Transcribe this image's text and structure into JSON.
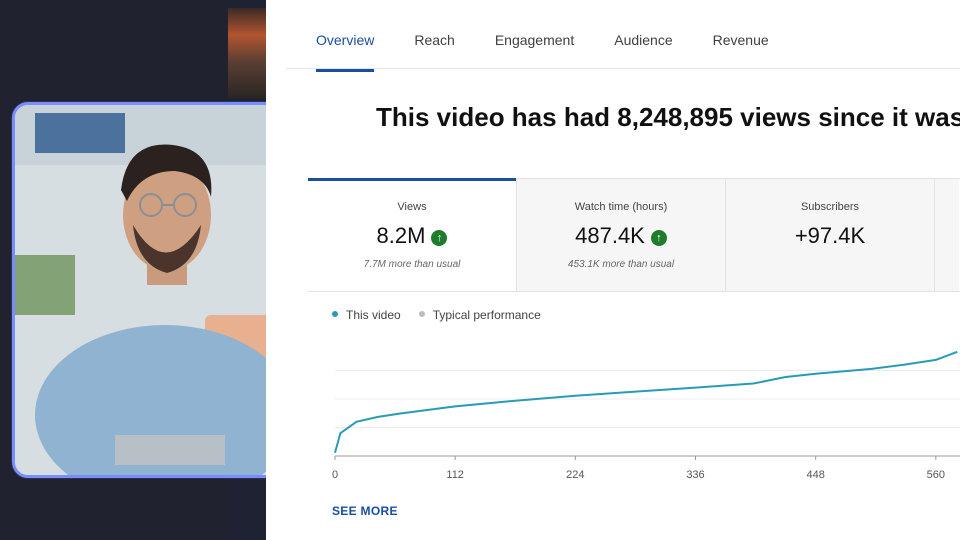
{
  "tabs": [
    {
      "label": "Overview",
      "active": true
    },
    {
      "label": "Reach",
      "active": false
    },
    {
      "label": "Engagement",
      "active": false
    },
    {
      "label": "Audience",
      "active": false
    },
    {
      "label": "Revenue",
      "active": false
    }
  ],
  "headline": "This video has had 8,248,895 views since it was",
  "cards": [
    {
      "title": "Views",
      "value": "8.2M",
      "sub": "7.7M more than usual",
      "trend_icon": "arrow-up-icon"
    },
    {
      "title": "Watch time (hours)",
      "value": "487.4K",
      "sub": "453.1K more than usual",
      "trend_icon": "arrow-up-icon"
    },
    {
      "title": "Subscribers",
      "value": "+97.4K",
      "sub": ""
    }
  ],
  "legend": [
    {
      "label": "This video",
      "color": "#2a9bb7"
    },
    {
      "label": "Typical performance",
      "color": "#bdbdbd"
    }
  ],
  "chart_data": {
    "type": "line",
    "x": [
      0,
      5,
      20,
      40,
      60,
      112,
      160,
      224,
      280,
      336,
      390,
      420,
      448,
      500,
      530,
      560,
      580
    ],
    "series": [
      {
        "name": "This video",
        "values": [
          0.2,
          1.4,
          2.1,
          2.4,
          2.6,
          3.05,
          3.35,
          3.7,
          3.95,
          4.2,
          4.45,
          4.85,
          5.05,
          5.35,
          5.6,
          5.9,
          6.4
        ]
      }
    ],
    "x_ticks": [
      "0",
      "112",
      "224",
      "336",
      "448",
      "560"
    ],
    "xlim": [
      0,
      600
    ],
    "ylim": [
      0,
      7
    ],
    "grid": true
  },
  "see_more": "SEE MORE"
}
